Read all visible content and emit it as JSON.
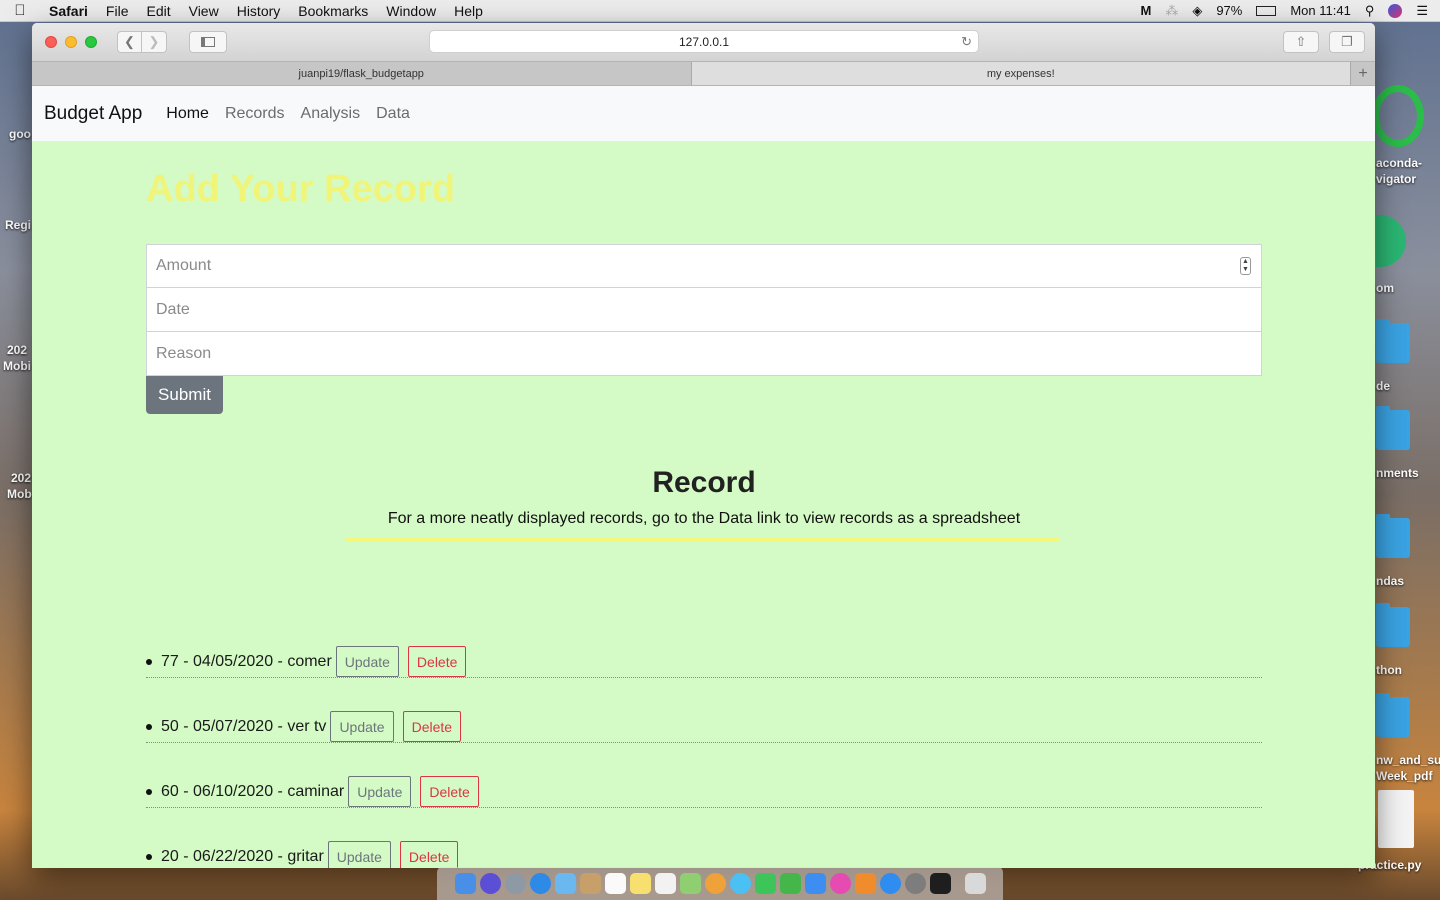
{
  "menubar": {
    "app": "Safari",
    "items": [
      "File",
      "Edit",
      "View",
      "History",
      "Bookmarks",
      "Window",
      "Help"
    ],
    "battery": "97%",
    "clock": "Mon 11:41"
  },
  "browser": {
    "url": "127.0.0.1",
    "tabs": [
      {
        "label": "juanpi19/flask_budgetapp",
        "active": false
      },
      {
        "label": "my expenses!",
        "active": true
      }
    ]
  },
  "app": {
    "brand": "Budget App",
    "nav": [
      "Home",
      "Records",
      "Analysis",
      "Data"
    ],
    "title": "Add Your Record",
    "form": {
      "amount_placeholder": "Amount",
      "date_placeholder": "Date",
      "reason_placeholder": "Reason",
      "submit_label": "Submit"
    },
    "record": {
      "heading": "Record",
      "subtitle": "For a more neatly displayed records, go to the Data link to view records as a spreadsheet"
    },
    "records": [
      {
        "text": "77 - 04/05/2020 - comer",
        "update": "Update",
        "delete": "Delete"
      },
      {
        "text": "50 - 05/07/2020 - ver tv",
        "update": "Update",
        "delete": "Delete"
      },
      {
        "text": "60 - 06/10/2020 - caminar",
        "update": "Update",
        "delete": "Delete"
      },
      {
        "text": "20 - 06/22/2020 - gritar",
        "update": "Update",
        "delete": "Delete"
      }
    ]
  },
  "desktop": {
    "labels": [
      "aconda-",
      "vigator",
      "om",
      "de",
      "nments",
      "ndas",
      "thon",
      "nw_and_su",
      "Week_pdf",
      "practice.py"
    ],
    "left_labels": [
      "goo",
      "Regi",
      "202",
      "Mobi",
      "202",
      "Mob"
    ]
  },
  "colors": {
    "page_bg": "#d4fac5",
    "title": "#f0f57a",
    "submit": "#6c757d",
    "delete": "#dc3545"
  }
}
